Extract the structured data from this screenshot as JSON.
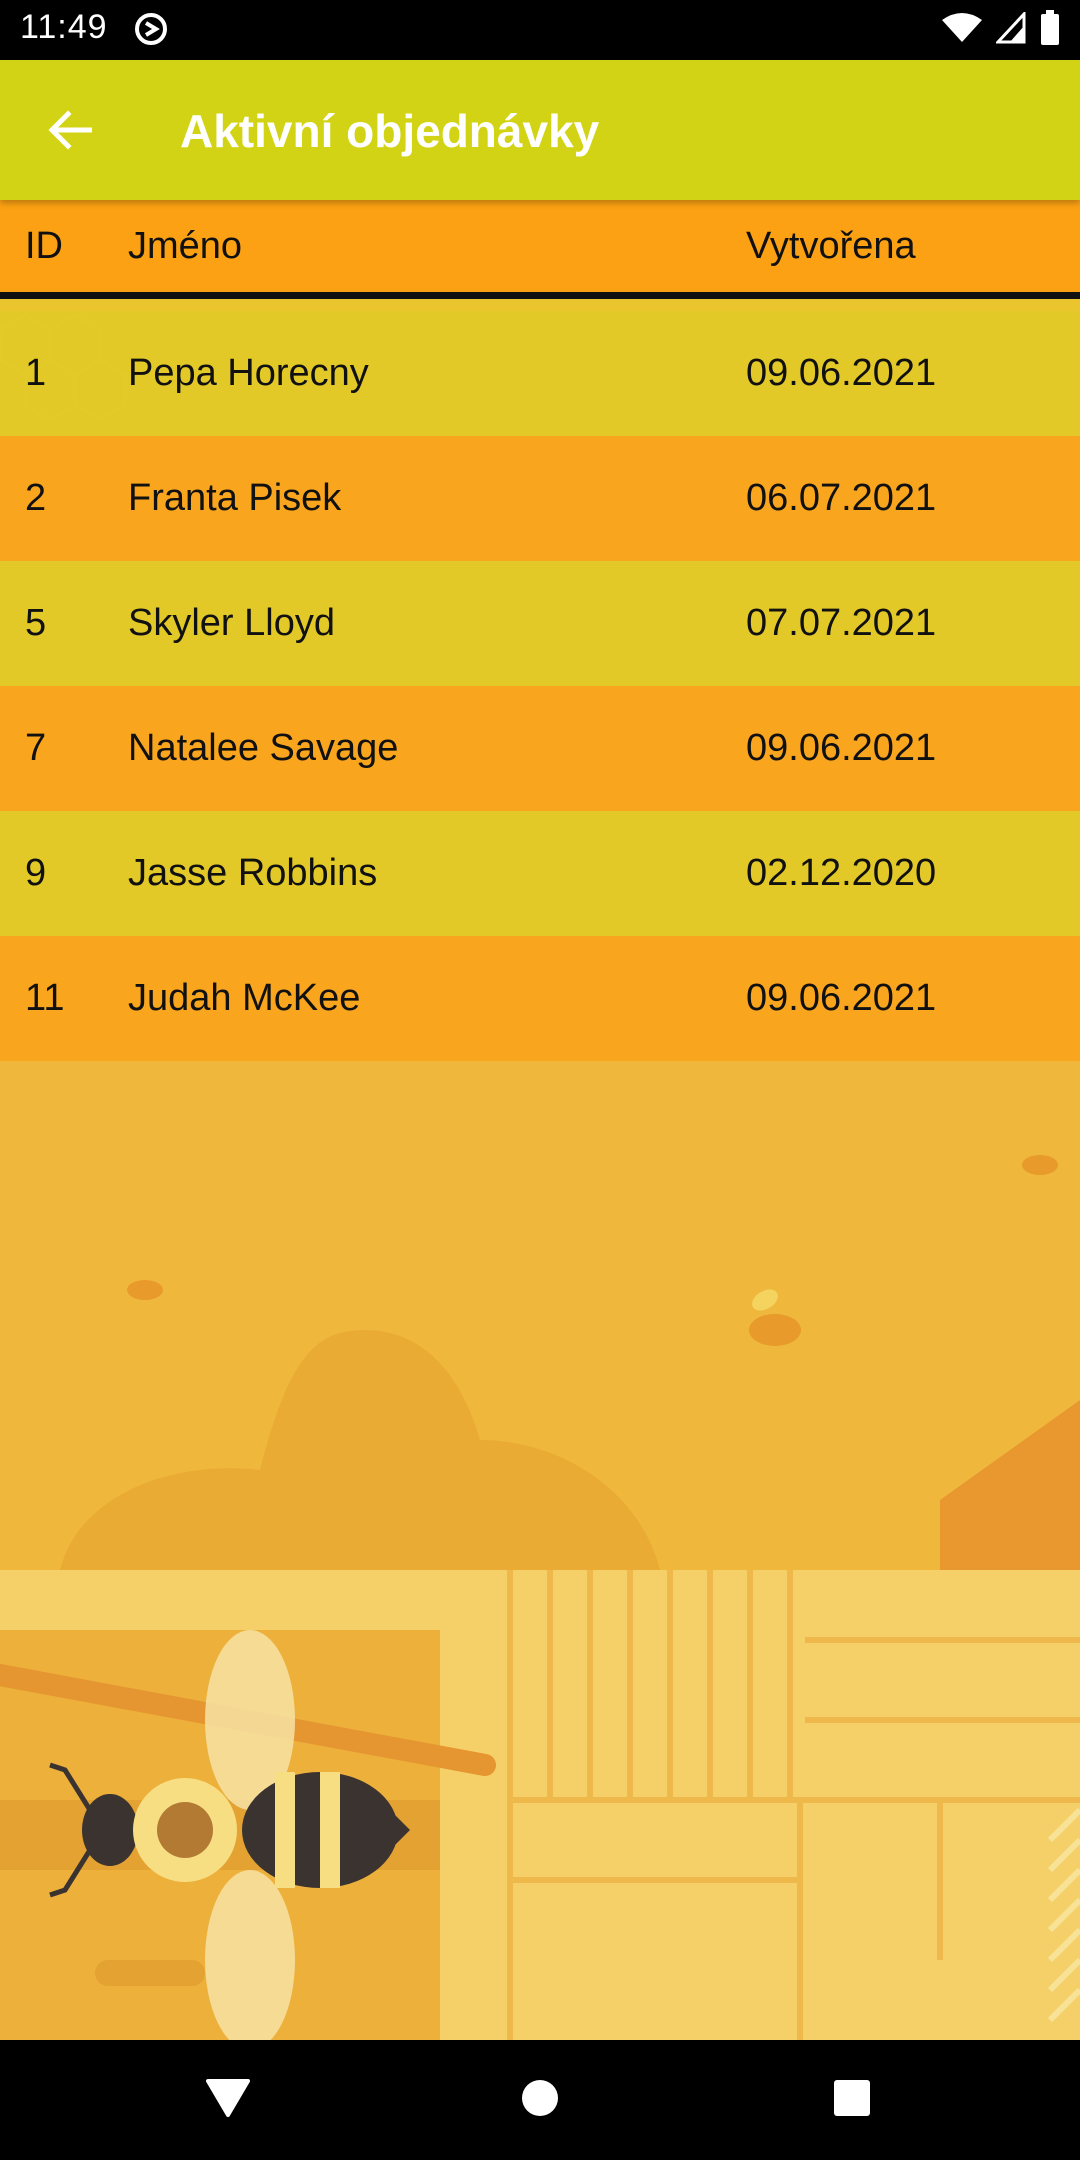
{
  "status_bar": {
    "time": "11:49",
    "icons": [
      "app-notification-icon",
      "wifi-icon",
      "signal-icon",
      "battery-icon"
    ]
  },
  "app_bar": {
    "back_icon": "arrow-left-icon",
    "title": "Aktivní objednávky"
  },
  "table": {
    "headers": {
      "id": "ID",
      "name": "Jméno",
      "created": "Vytvořena"
    },
    "rows": [
      {
        "id": "1",
        "name": "Pepa Horecny",
        "created": "09.06.2021"
      },
      {
        "id": "2",
        "name": "Franta Pisek",
        "created": "06.07.2021"
      },
      {
        "id": "5",
        "name": "Skyler Lloyd",
        "created": "07.07.2021"
      },
      {
        "id": "7",
        "name": "Natalee Savage",
        "created": "09.06.2021"
      },
      {
        "id": "9",
        "name": "Jasse Robbins",
        "created": "02.12.2020"
      },
      {
        "id": "11",
        "name": "Judah McKee",
        "created": "09.06.2021"
      }
    ]
  },
  "nav_bar": {
    "icons": [
      "back-triangle-icon",
      "home-circle-icon",
      "recents-square-icon"
    ]
  },
  "colors": {
    "app_bar": "#d3d315",
    "header_row": "#fca113",
    "row_yellow": "#e2ca26",
    "row_orange": "#faa219",
    "background": "#efb83d"
  }
}
